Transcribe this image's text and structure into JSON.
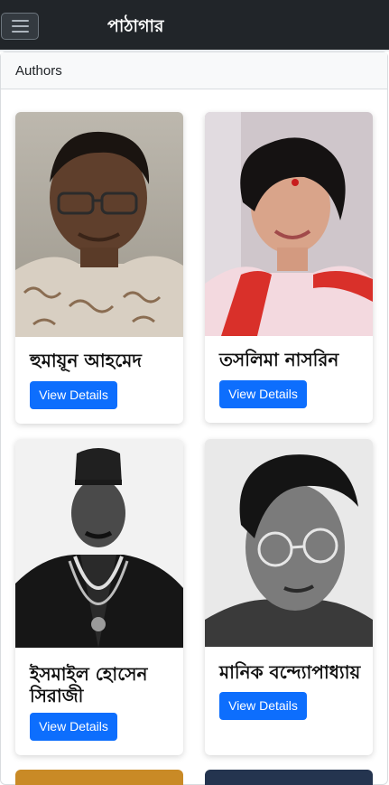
{
  "navbar": {
    "brand": "পাঠাগার",
    "menu_icon": "hamburger-menu-icon"
  },
  "section": {
    "title": "Authors"
  },
  "authors": [
    {
      "name": "হুমায়ূন আহমেদ",
      "button_label": "View Details"
    },
    {
      "name": "তসলিমা নাসরিন",
      "button_label": "View Details"
    },
    {
      "name": "ইসমাইল হোসেন সিরাজী",
      "button_label": "View Details"
    },
    {
      "name": "মানিক বন্দ্যোপাধ্যায়",
      "button_label": "View Details"
    }
  ],
  "colors": {
    "navbar_bg": "#212529",
    "primary_button": "#0d6efd",
    "header_bg": "#f8f9fa"
  }
}
